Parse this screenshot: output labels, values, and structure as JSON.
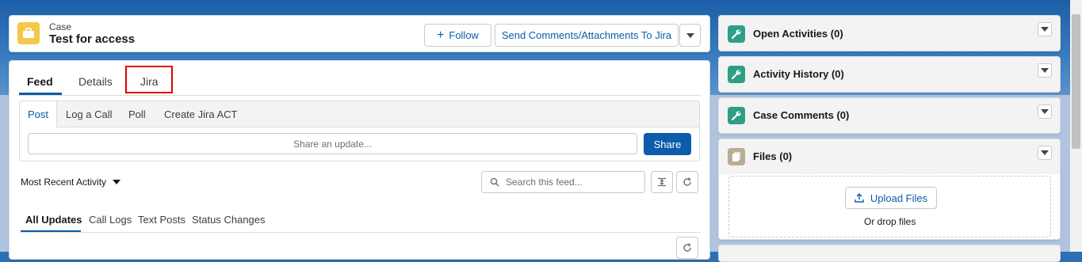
{
  "header": {
    "object_label": "Case",
    "record_title": "Test for access",
    "follow_label": "Follow",
    "send_label": "Send Comments/Attachments To Jira"
  },
  "record_tabs": [
    "Feed",
    "Details",
    "Jira"
  ],
  "publisher": {
    "tabs": [
      "Post",
      "Log a Call",
      "Poll",
      "Create Jira ACT"
    ],
    "share_placeholder": "Share an update...",
    "share_button": "Share"
  },
  "feed": {
    "sort_label": "Most Recent Activity",
    "search_placeholder": "Search this feed...",
    "filters": [
      "All Updates",
      "Call Logs",
      "Text Posts",
      "Status Changes"
    ]
  },
  "related": {
    "open_activities": "Open Activities (0)",
    "activity_history": "Activity History (0)",
    "case_comments": "Case Comments (0)",
    "files": "Files (0)",
    "upload_label": "Upload Files",
    "drop_label": "Or drop files"
  },
  "colors": {
    "brand": "#0b5cab",
    "case_icon": "#f2c94c",
    "activity_icon": "#2e9e87",
    "files_icon": "#baac93",
    "highlight": "#e00000"
  }
}
